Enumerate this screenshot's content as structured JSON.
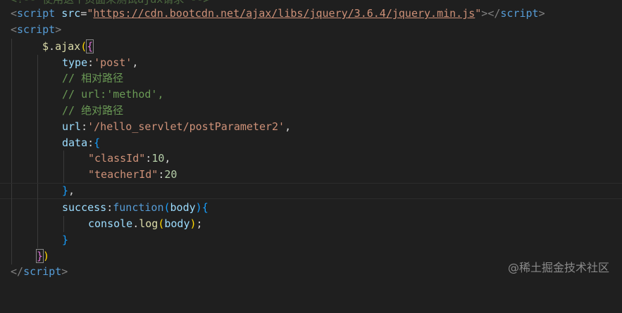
{
  "code": {
    "cut_top_line": "<!-- 使用这个页面来测试ajax请求 -->",
    "l1_src_value": "https://cdn.bootcdn.net/ajax/libs/jquery/3.6.4/jquery.min.js",
    "l2": "script",
    "ajax_obj": "$",
    "ajax_fn": "ajax",
    "type_key": "type",
    "type_val": "'post'",
    "comment_relative": "// 相对路径",
    "comment_url": "// url:'method',",
    "comment_absolute": "// 绝对路径",
    "url_key": "url",
    "url_val": "'/hello_servlet/postParameter2'",
    "data_key": "data",
    "classId_key": "\"classId\"",
    "classId_val": "10",
    "teacherId_key": "\"teacherId\"",
    "teacherId_val": "20",
    "success_key": "success",
    "function_kw": "function",
    "param": "body",
    "console_obj": "console",
    "log_fn": "log",
    "log_arg": "body"
  },
  "watermark": "@稀土掘金技术社区"
}
